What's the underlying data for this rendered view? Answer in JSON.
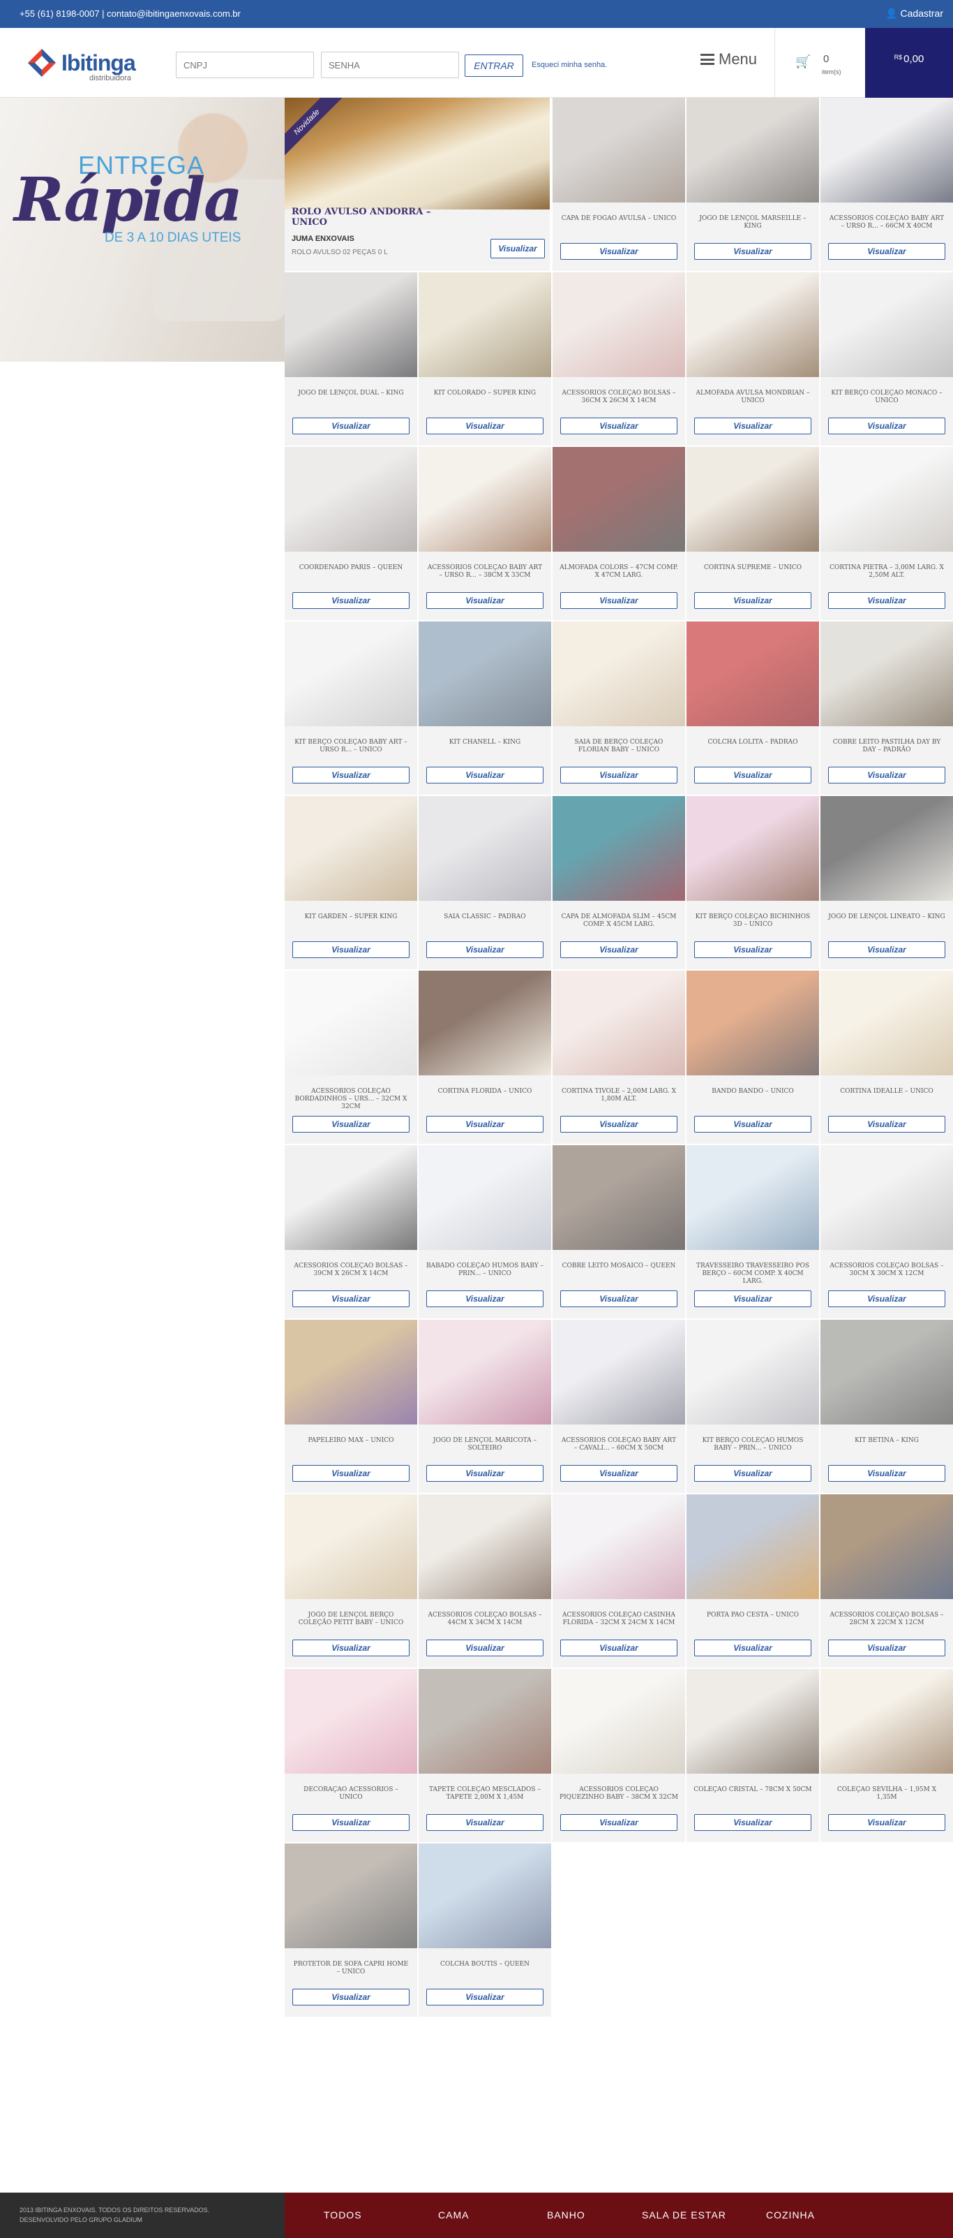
{
  "topbar": {
    "contact": "+55 (61) 8198-0007 | contato@ibitingaenxovais.com.br",
    "register_label": "Cadastrar"
  },
  "header": {
    "logo_name": "Ibitinga",
    "logo_sub": "distribuidora",
    "cnpj_placeholder": "CNPJ",
    "password_placeholder": "SENHA",
    "enter_label": "ENTRAR",
    "forgot_label": "Esqueci minha senha.",
    "menu_label": "Menu",
    "cart_count": "0",
    "cart_items_label": "item(s)",
    "currency": "R$",
    "cart_total": "0,00",
    "cart_icon": "cart-icon",
    "user_icon": "user-icon"
  },
  "banner": {
    "line1": "ENTREGA",
    "line2": "Rápida",
    "line3": "DE 3 A 10 DIAS UTEIS"
  },
  "featured": {
    "ribbon": "Novidade",
    "title": "ROLO AVULSO ANDORRA – UNICO",
    "brand": "JUMA ENXOVAIS",
    "desc": "ROLO AVULSO 02 PEÇAS 0 L",
    "button": "Visualizar"
  },
  "view_label": "Visualizar",
  "products": [
    {
      "title": "CAPA DE FOGÃO AVULSA – UNICO",
      "c1": "#c9c5c2",
      "c2": "#8a7a6e"
    },
    {
      "title": "JOGO DE LENÇOL MARSEILLE – KING",
      "c1": "#cfcac5",
      "c2": "#5a5550"
    },
    {
      "title": "ACESSÓRIOS COLEÇÃO BABY ART – URSO R... – 66CM X 40CM",
      "c1": "#e8e8ea",
      "c2": "#3a3e52"
    },
    {
      "title": "JOGO DE LENÇOL DUAL – KING",
      "c1": "#d6d3d0",
      "c2": "#3c3b40"
    },
    {
      "title": "KIT COLORADO – SUPER KING",
      "c1": "#e3dcc8",
      "c2": "#8a7650"
    },
    {
      "title": "ACESSÓRIOS COLEÇÃO BOLSAS – 36CM X 26CM X 14CM",
      "c1": "#eae0dc",
      "c2": "#c99a98"
    },
    {
      "title": "ALMOFADA AVULSA MONDRIAN – UNICO",
      "c1": "#ece6de",
      "c2": "#7a5a3a"
    },
    {
      "title": "KIT BERÇO COLEÇÃO MÔNACO – UNICO",
      "c1": "#ececec",
      "c2": "#a8a8a8"
    },
    {
      "title": "COORDENADO PARIS – QUEEN",
      "c1": "#e6e4e2",
      "c2": "#9a9290"
    },
    {
      "title": "ACESSÓRIOS COLEÇÃO BABY ART – URSO R... – 38CM X 33CM",
      "c1": "#f0eae2",
      "c2": "#8a5a3a"
    },
    {
      "title": "ALMOFADA COLORS – 47CM COMP. X 47CM LARG.",
      "c1": "#7a2e2e",
      "c2": "#3a3a3a"
    },
    {
      "title": "CORTINA SUPREME – UNICO",
      "c1": "#e8e0d4",
      "c2": "#6a4a2e"
    },
    {
      "title": "CORTINA PIETRA – 3,00M LARG. X 2,50M ALT.",
      "c1": "#f2f2f2",
      "c2": "#bdb8b2"
    },
    {
      "title": "KIT BERÇO COLEÇÃO BABY ART – URSO R... – UNICO",
      "c1": "#f0f0f0",
      "c2": "#bcbcbc"
    },
    {
      "title": "KIT CHANELL – KING",
      "c1": "#8aa0b4",
      "c2": "#4a5a6a"
    },
    {
      "title": "SAIA DE BERÇO COLEÇÃO FLORIAN BABY – UNICO",
      "c1": "#efe6d6",
      "c2": "#c8b498"
    },
    {
      "title": "COLCHA LOLITA – PADRÃO",
      "c1": "#c83a3a",
      "c2": "#8a1e22"
    },
    {
      "title": "COBRE LEITO PASTILHA DAY BY DAY – PADRÃO",
      "c1": "#d8d4cc",
      "c2": "#6a5a44"
    },
    {
      "title": "KIT GARDEN – SUPER KING",
      "c1": "#ece4d6",
      "c2": "#b49a72"
    },
    {
      "title": "SAIA CLASSIC – PADRÃO",
      "c1": "#dedee2",
      "c2": "#9a9aa4"
    },
    {
      "title": "CAPA DE ALMOFADA SLIM – 45CM COMP. X 45CM LARG.",
      "c1": "#1e7a8a",
      "c2": "#7a1e2e"
    },
    {
      "title": "KIT BERÇO COLEÇÃO BICHINHOS 3D – UNICO",
      "c1": "#e8c6d8",
      "c2": "#7a4a3a"
    },
    {
      "title": "JOGO DE LENÇOL LINEATO – KING",
      "c1": "#4a4a4c",
      "c2": "#d8d4cc"
    },
    {
      "title": "ACESSÓRIOS COLEÇÃO BORDADINHOS – URS... – 32CM X 32CM",
      "c1": "#f6f6f6",
      "c2": "#d8d8d8"
    },
    {
      "title": "CORTINA FLÓRIDA – UNICO",
      "c1": "#5a3a2a",
      "c2": "#e8e0d0"
    },
    {
      "title": "CORTINA TIVOLE – 2,00M LARG. X 1,80M ALT.",
      "c1": "#f0e4e0",
      "c2": "#c89890"
    },
    {
      "title": "BANDÔ BANDÔ – UNICO",
      "c1": "#d88a5a",
      "c2": "#4a3a3a"
    },
    {
      "title": "CORTINA IDEALLE – UNICO",
      "c1": "#f4ecdc",
      "c2": "#c8b490"
    },
    {
      "title": "ACESSÓRIOS COLEÇÃO BOLSAS – 39CM X 26CM X 14CM",
      "c1": "#eaeaea",
      "c2": "#3a3a3a"
    },
    {
      "title": "BABADO COLEÇÃO HUMOS BABY – PRIN... – UNICO",
      "c1": "#eceef2",
      "c2": "#b8bcc8"
    },
    {
      "title": "COBRE LEITO MOSAICO – QUEEN",
      "c1": "#8a7a6e",
      "c2": "#3a3230"
    },
    {
      "title": "TRAVESSEIRO TRAVESSEIRO PÓS BERÇO – 60CM COMP. X 40CM LARG.",
      "c1": "#d8e4ee",
      "c2": "#6a8aa8"
    },
    {
      "title": "ACESSÓRIOS COLEÇÃO BOLSAS – 30CM X 30CM X 12CM",
      "c1": "#eeeeee",
      "c2": "#b0b0b0"
    },
    {
      "title": "PAPELEIRO MAX – UNICO",
      "c1": "#c8a878",
      "c2": "#6a4a8a"
    },
    {
      "title": "JOGO DE LENÇOL MARICOTA – SOLTEIRO",
      "c1": "#eed8e0",
      "c2": "#b46a8a"
    },
    {
      "title": "ACESSÓRIOS COLEÇÃO BABY ART – CAVALI... – 60CM X 50CM",
      "c1": "#e8e8ee",
      "c2": "#7a7a8a"
    },
    {
      "title": "KIT BERÇO COLEÇÃO HUMOS BABY – PRIN... – UNICO",
      "c1": "#eeeeee",
      "c2": "#a8a8b0"
    },
    {
      "title": "KIT BETINA – KING",
      "c1": "#9a9a96",
      "c2": "#4a4a48"
    },
    {
      "title": "JOGO DE LENÇOL BERÇO COLEÇÃO PETIT BABY – UNICO",
      "c1": "#f0e8d8",
      "c2": "#c8b08a"
    },
    {
      "title": "ACESSÓRIOS COLEÇÃO BOLSAS – 44CM X 34CM X 14CM",
      "c1": "#e8e4dc",
      "c2": "#6a5040"
    },
    {
      "title": "ACESSÓRIOS COLEÇÃO CASINHA FLORIDA – 32CM X 24CM X 14CM",
      "c1": "#f0eef0",
      "c2": "#c890a8"
    },
    {
      "title": "PORTA PÃO CESTA – UNICO",
      "c1": "#a8b4c8",
      "c2": "#c88a3a"
    },
    {
      "title": "ACESSÓRIOS COLEÇÃO BOLSAS – 28CM X 22CM X 12CM",
      "c1": "#8a6a4a",
      "c2": "#2a3a5a"
    },
    {
      "title": "DECORAÇÃO ACESSÓRIOS – UNICO",
      "c1": "#f4d8e0",
      "c2": "#d890a8"
    },
    {
      "title": "TAPETE COLEÇÃO MESCLADOS – TAPETE 2,00M X 1,45M",
      "c1": "#a8a098",
      "c2": "#7a4a3a"
    },
    {
      "title": "ACESSÓRIOS COLEÇÃO PIQUEZINHO BABY – 38CM X 32CM",
      "c1": "#f4f2ee",
      "c2": "#c8c0b0"
    },
    {
      "title": "COLEÇÃO CRISTAL – 78CM X 50CM",
      "c1": "#e8e4de",
      "c2": "#5a4a3a"
    },
    {
      "title": "COLEÇÃO SEVILHA – 1,95M X 1,35M",
      "c1": "#f2ece0",
      "c2": "#8a6a4a"
    },
    {
      "title": "PROTETOR DE SOFÁ CAPRI HOME – UNICO",
      "c1": "#a89e94",
      "c2": "#4a4a4a"
    },
    {
      "title": "COLCHA BOUTIS – QUEEN",
      "c1": "#b8cce0",
      "c2": "#5a6a8a"
    }
  ],
  "footer": {
    "copyright": "2013 IBITINGA ENXOVAIS. TODOS OS DIREITOS RESERVADOS.",
    "developer": "DESENVOLVIDO PELO GRUPO GLADIUM",
    "nav": [
      "TODOS",
      "CAMA",
      "BANHO",
      "SALA DE ESTAR",
      "COZINHA"
    ]
  }
}
